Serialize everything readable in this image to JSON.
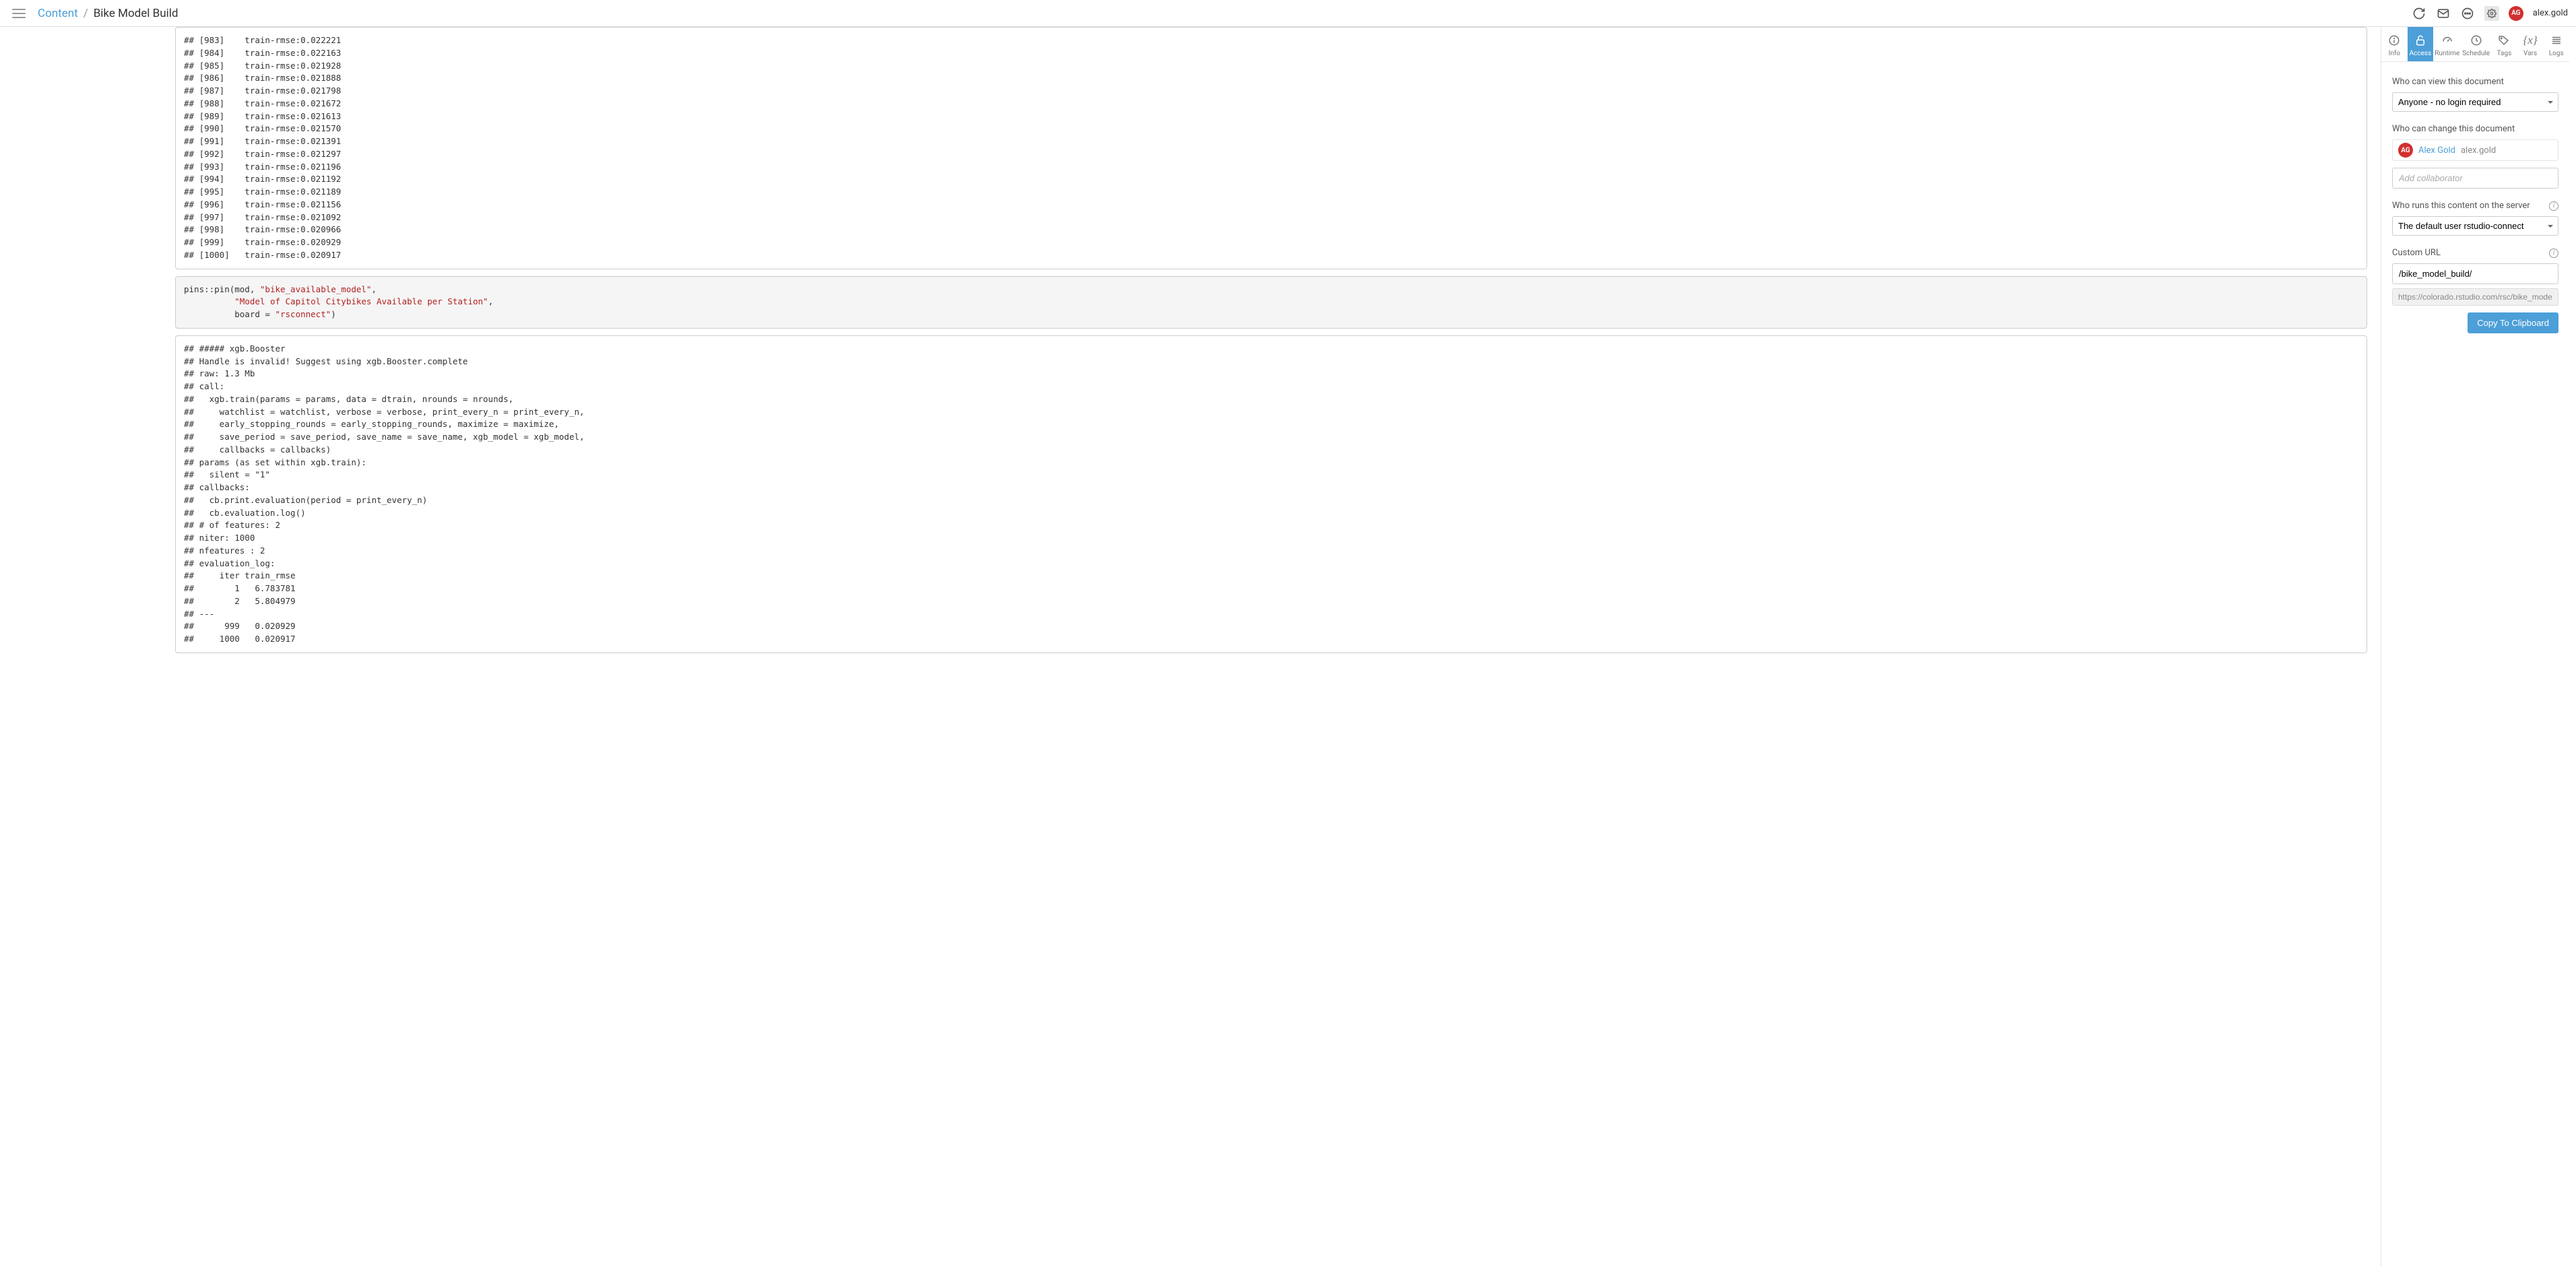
{
  "breadcrumb": {
    "root": "Content",
    "current": "Bike Model Build"
  },
  "user": {
    "initials": "AG",
    "username": "alex.gold"
  },
  "tabs": {
    "items": [
      {
        "label": "Info"
      },
      {
        "label": "Access"
      },
      {
        "label": "Runtime"
      },
      {
        "label": "Schedule"
      },
      {
        "label": "Tags"
      },
      {
        "label": "Vars"
      },
      {
        "label": "Logs"
      }
    ],
    "activeIndex": 1
  },
  "access": {
    "viewLabel": "Who can view this document",
    "viewValue": "Anyone - no login required",
    "changeLabel": "Who can change this document",
    "ownerInitials": "AG",
    "ownerName": "Alex Gold",
    "ownerUser": "alex.gold",
    "addCollabPlaceholder": "Add collaborator",
    "runAsLabel": "Who runs this content on the server",
    "runAsValue": "The default user rstudio-connect",
    "customUrlLabel": "Custom URL",
    "customUrlValue": "/bike_model_build/",
    "fullUrl": "https://colorado.rstudio.com/rsc/bike_model_build/",
    "copyBtn": "Copy To Clipboard"
  },
  "code": {
    "block1": "## [983]    train-rmse:0.022221\n## [984]    train-rmse:0.022163\n## [985]    train-rmse:0.021928\n## [986]    train-rmse:0.021888\n## [987]    train-rmse:0.021798\n## [988]    train-rmse:0.021672\n## [989]    train-rmse:0.021613\n## [990]    train-rmse:0.021570\n## [991]    train-rmse:0.021391\n## [992]    train-rmse:0.021297\n## [993]    train-rmse:0.021196\n## [994]    train-rmse:0.021192\n## [995]    train-rmse:0.021189\n## [996]    train-rmse:0.021156\n## [997]    train-rmse:0.021092\n## [998]    train-rmse:0.020966\n## [999]    train-rmse:0.020929\n## [1000]   train-rmse:0.020917",
    "block2": {
      "pre1": "pins::pin(mod, ",
      "str1": "\"bike_available_model\"",
      "mid1": ",\n          ",
      "str2": "\"Model of Capitol Citybikes Available per Station\"",
      "mid2": ",\n          board = ",
      "str3": "\"rsconnect\"",
      "post": ")"
    },
    "block3": "## ##### xgb.Booster\n## Handle is invalid! Suggest using xgb.Booster.complete\n## raw: 1.3 Mb\n## call:\n##   xgb.train(params = params, data = dtrain, nrounds = nrounds,\n##     watchlist = watchlist, verbose = verbose, print_every_n = print_every_n,\n##     early_stopping_rounds = early_stopping_rounds, maximize = maximize,\n##     save_period = save_period, save_name = save_name, xgb_model = xgb_model,\n##     callbacks = callbacks)\n## params (as set within xgb.train):\n##   silent = \"1\"\n## callbacks:\n##   cb.print.evaluation(period = print_every_n)\n##   cb.evaluation.log()\n## # of features: 2\n## niter: 1000\n## nfeatures : 2\n## evaluation_log:\n##     iter train_rmse\n##        1   6.783781\n##        2   5.804979\n## ---\n##      999   0.020929\n##     1000   0.020917"
  }
}
